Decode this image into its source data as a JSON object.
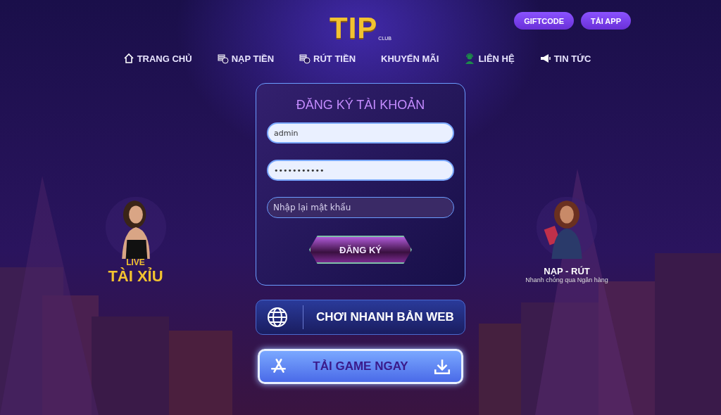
{
  "header": {
    "logo": {
      "main": "TIP",
      "sub": "CLUB"
    },
    "buttons": [
      {
        "label": "GIFTCODE"
      },
      {
        "label": "TẢI APP"
      }
    ]
  },
  "nav": [
    {
      "label": "TRANG CHỦ",
      "kind": "home"
    },
    {
      "label": "NẠP TIỀN",
      "kind": "coins"
    },
    {
      "label": "RÚT TIỀN",
      "kind": "coins"
    },
    {
      "label": "KHUYẾN MÃI",
      "kind": "none"
    },
    {
      "label": "LIÊN HỆ",
      "kind": "support"
    },
    {
      "label": "TIN TỨC",
      "kind": "megaphone"
    }
  ],
  "form": {
    "title": "ĐĂNG KÝ TÀI KHOẢN",
    "fields": [
      {
        "value": "admin"
      },
      {
        "value": "•••••••••••"
      },
      {
        "placeholder": "Nhập lại mật khẩu"
      }
    ],
    "submit": "ĐĂNG KÝ"
  },
  "left_promo": {
    "tag": "LIVE",
    "title": "TÀI XỈU"
  },
  "right_promo": {
    "title": "NẠP - RÚT",
    "subtitle": "Nhanh chóng qua Ngân hàng"
  },
  "web_button": {
    "label": "CHƠI NHANH BẢN WEB"
  },
  "download_button": {
    "label": "TẢI GAME NGAY"
  }
}
